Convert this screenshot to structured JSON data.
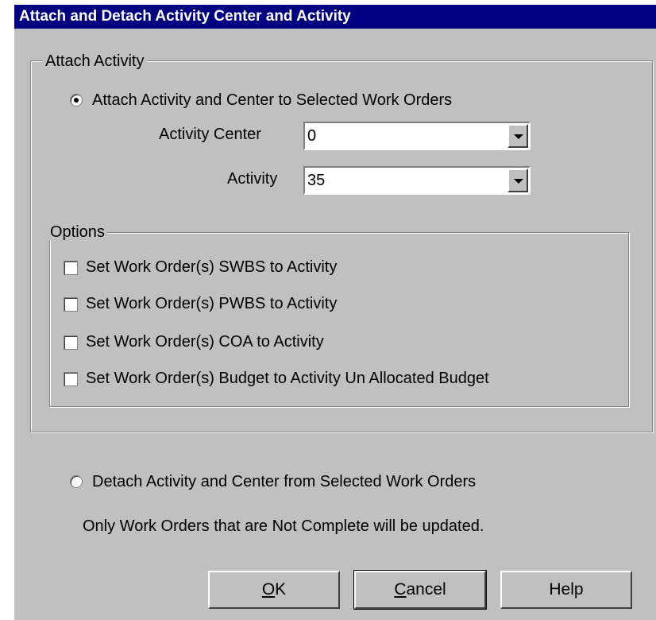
{
  "window": {
    "title": "Attach and Detach Activity Center and Activity"
  },
  "attach_group": {
    "legend": "Attach Activity",
    "radio_label": "Attach Activity and Center to Selected Work Orders",
    "activity_center": {
      "label": "Activity Center",
      "value": "0"
    },
    "activity": {
      "label": "Activity",
      "value": "35"
    }
  },
  "options_group": {
    "legend": "Options",
    "items": [
      {
        "label": "Set Work Order(s) SWBS to Activity",
        "checked": false
      },
      {
        "label": "Set Work Order(s) PWBS to Activity",
        "checked": false
      },
      {
        "label": "Set Work Order(s) COA to Activity",
        "checked": false
      },
      {
        "label": "Set Work Order(s) Budget to Activity Un Allocated Budget",
        "checked": false
      }
    ]
  },
  "detach": {
    "radio_label": "Detach Activity and Center from Selected Work Orders",
    "note": "Only Work Orders that are Not Complete will be updated."
  },
  "buttons": {
    "ok_mnemonic": "O",
    "ok_rest": "K",
    "cancel_mnemonic": "C",
    "cancel_rest": "ancel",
    "help": "Help"
  },
  "colors": {
    "titlebar": "#000080",
    "face": "#c0c0c0"
  },
  "icons": {
    "combo_arrow": "chevron-down-icon"
  }
}
